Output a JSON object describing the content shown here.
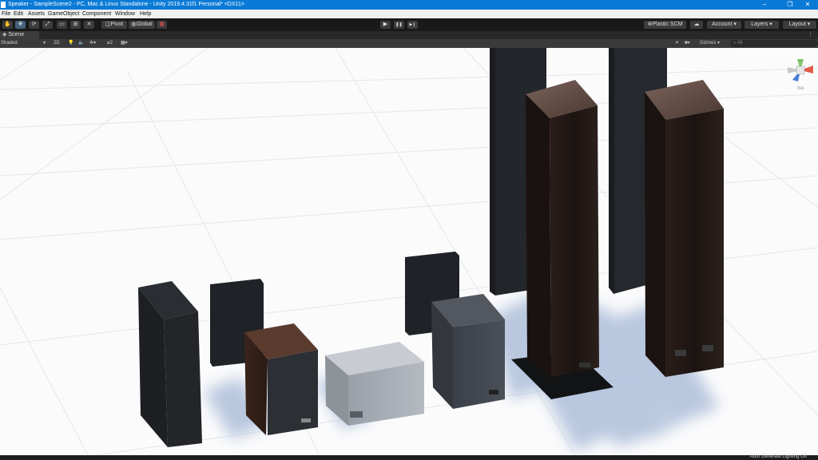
{
  "window": {
    "title": "Speaker - SampleScene2 - PC, Mac & Linux Standalone - Unity 2019.4.31f1 Personal* <DX11>",
    "minimize": "–",
    "maximize": "❐",
    "close": "✕"
  },
  "menu": [
    "File",
    "Edit",
    "Assets",
    "GameObject",
    "Component",
    "Window",
    "Help"
  ],
  "toolbar": {
    "tools": [
      "hand-icon",
      "move-icon",
      "rotate-icon",
      "scale-icon",
      "rect-icon",
      "transform-icon",
      "custom-tool-icon"
    ],
    "pivot_label": "Pivot",
    "global_label": "Global",
    "play": "▶",
    "pause": "❚❚",
    "step": "▶❙",
    "plastic_label": "Plastic SCM",
    "account_label": "Account",
    "layers_label": "Layers",
    "layout_label": "Layout"
  },
  "scene_tab": {
    "label": "Scene"
  },
  "scene_toolbar": {
    "shading_mode": "Shaded",
    "mode_2d": "2D",
    "gizmos_label": "Gizmos",
    "search_placeholder": "All",
    "layer_count": "2"
  },
  "gizmo": {
    "label": "Iso"
  },
  "status": {
    "text": "Auto Generate Lighting Off"
  },
  "colors": {
    "titlebar": "#0a7ad6",
    "toolbar": "#191919",
    "floor": "#fbfbfc",
    "shadow": "#a9bbd8"
  }
}
